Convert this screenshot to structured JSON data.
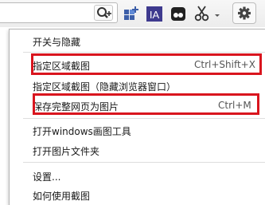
{
  "menu": {
    "items": [
      {
        "label": "开关与隐藏",
        "shortcut": ""
      },
      {
        "label": "指定区域截图",
        "shortcut": "Ctrl+Shift+X"
      },
      {
        "label": "指定区域截图（隐藏浏览器窗口）",
        "shortcut": ""
      },
      {
        "label": "保存完整网页为图片",
        "shortcut": "Ctrl+M"
      },
      {
        "label": "打开windows画图工具",
        "shortcut": ""
      },
      {
        "label": "打开图片文件夹",
        "shortcut": ""
      },
      {
        "label": "设置...",
        "shortcut": ""
      },
      {
        "label": "如何使用截图",
        "shortcut": ""
      }
    ]
  },
  "toolbar": {
    "icons": [
      "zoom-in-icon",
      "apps-grid-icon",
      "ia-extension-icon",
      "spy-extension-icon",
      "scissors-icon",
      "chevron-down-icon",
      "gear-icon"
    ],
    "ia_text": "IA"
  },
  "colors": {
    "highlight": "#d9151e",
    "ia_bg": "#3e3a8e"
  }
}
